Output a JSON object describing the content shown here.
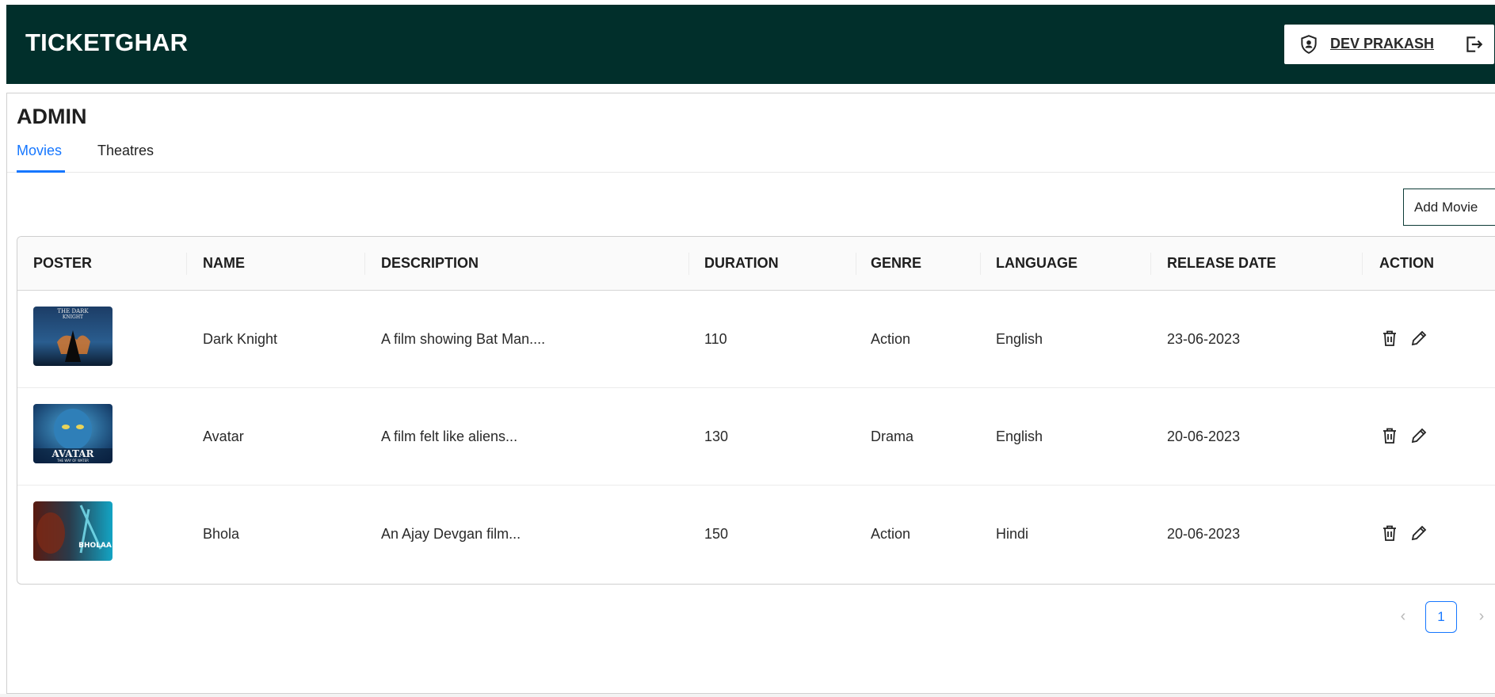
{
  "header": {
    "brand": "TICKETGHAR",
    "user_name": "DEV PRAKASH",
    "icons": {
      "user": "shield-user-icon",
      "logout": "logout-icon"
    },
    "bg_color": "#012f2b"
  },
  "page": {
    "title": "ADMIN",
    "tabs": [
      {
        "label": "Movies",
        "active": true
      },
      {
        "label": "Theatres",
        "active": false
      }
    ],
    "add_button": "Add Movie"
  },
  "table": {
    "columns": [
      "POSTER",
      "NAME",
      "DESCRIPTION",
      "DURATION",
      "GENRE",
      "LANGUAGE",
      "RELEASE DATE",
      "ACTION"
    ],
    "rows": [
      {
        "poster": "dark-knight-poster",
        "name": "Dark Knight",
        "description": "A film showing Bat Man....",
        "duration": "110",
        "genre": "Action",
        "language": "English",
        "release_date": "23-06-2023"
      },
      {
        "poster": "avatar-poster",
        "name": "Avatar",
        "description": "A film felt like aliens...",
        "duration": "130",
        "genre": "Drama",
        "language": "English",
        "release_date": "20-06-2023"
      },
      {
        "poster": "bhola-poster",
        "name": "Bhola",
        "description": "An Ajay Devgan film...",
        "duration": "150",
        "genre": "Action",
        "language": "Hindi",
        "release_date": "20-06-2023"
      }
    ],
    "poster_texts": {
      "dark_knight": [
        "THE DARK",
        "KNIGHT"
      ],
      "avatar": [
        "AVATAR",
        "THE WAY OF WATER"
      ],
      "bhola": [
        "BHOLAA"
      ]
    },
    "action_icons": [
      "delete-icon",
      "edit-icon"
    ]
  },
  "pagination": {
    "current_page": "1",
    "prev": "‹",
    "next": "›"
  },
  "colors": {
    "accent": "#1677ff",
    "header": "#012f2b"
  }
}
